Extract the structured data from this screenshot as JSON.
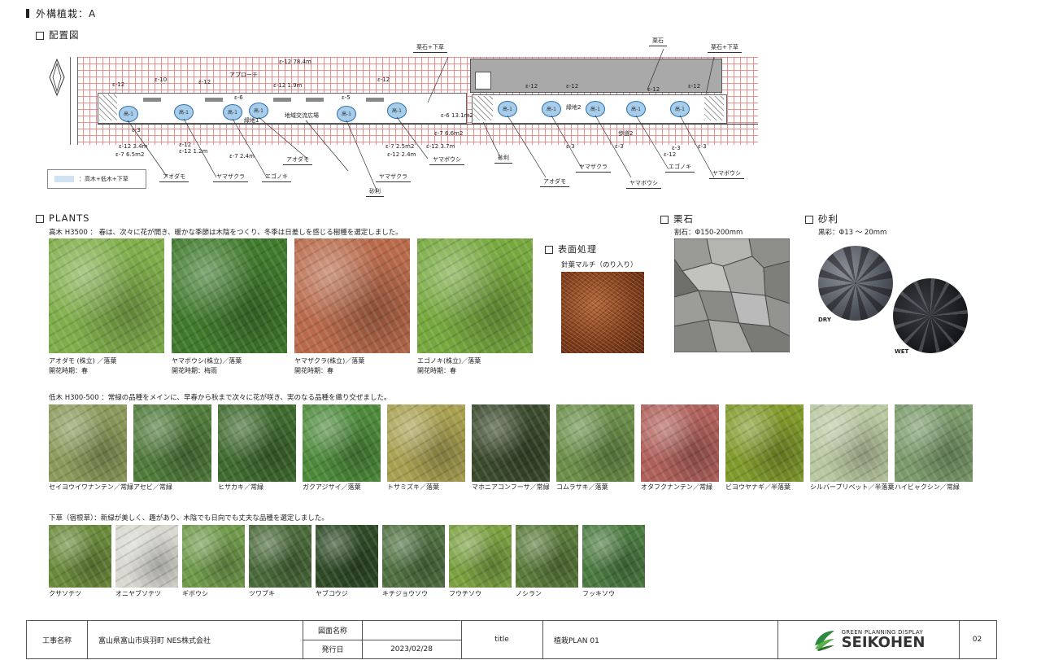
{
  "header": {
    "title": "外構植栽：A"
  },
  "layout_plan": {
    "title": "配置図",
    "legend": "：高木+低木+下草",
    "labels": {
      "approach": "アプローチ",
      "community_plaza": "地域交流広場",
      "green1": "緑地1",
      "green2": "緑地2",
      "walkway": "歩道2",
      "kuriishi_shitakusa_1": "栗石+下草",
      "kuriishi": "栗石",
      "kuriishi_shitakusa_2": "栗石+下草",
      "aodamo_1": "アオダモ",
      "yamazakura_1": "ヤマザクラ",
      "egonoki_1": "エゴノキ",
      "aodamo_2": "アオダモ",
      "jari_1": "砂利",
      "yamazakura_2": "ヤマザクラ",
      "yamaboushi_1": "ヤマボウシ",
      "jari_2": "砂利",
      "aodamo_3": "アオダモ",
      "yamazakura_3": "ヤマザクラ",
      "yamaboushi_2": "ヤマボウシ",
      "egonoki_2": "エゴノキ",
      "yamaboushi_3": "ヤマボウシ"
    },
    "tree_label": "高-1",
    "area_labels": [
      "ε-12 78.4m",
      "ε-10",
      "ε-12",
      "ε-12",
      "ε-6",
      "ε-12 1.9m",
      "ε-12",
      "ε-5",
      "ε-12 3.4m",
      "ε-7 6.5m2",
      "ε-12 1.2m",
      "ε-7 2.4m",
      "ε-7 2.5m2",
      "ε-12 2.4m",
      "ε-6 13.1m2",
      "ε-7 6.6m2",
      "ε-12 3.7m",
      "ε-12",
      "ε-12",
      "ε-12",
      "ε-12",
      "ε-3",
      "ε-3",
      "ε-3",
      "ε-3",
      "ε-12",
      "ε-12",
      "ε-3"
    ]
  },
  "plants": {
    "title": "PLANTS",
    "tall_intro": "高木 H3500 ： 春は、次々に花が開き、暖かな季節は木陰をつくり、冬季は日差しを感じる樹種を選定しました。",
    "tall": [
      {
        "name": "アオダモ (株立) ／落葉",
        "bloom": "開花時期：春",
        "color": "#7fae4a"
      },
      {
        "name": "ヤマボウシ(株立)／落葉",
        "bloom": "開花時期：梅雨",
        "color": "#3f7a2c"
      },
      {
        "name": "ヤマザクラ(株立)／落葉",
        "bloom": "開花時期：春",
        "color": "#b86a4a"
      },
      {
        "name": "エゴノキ(株立)／落葉",
        "bloom": "開花時期：春",
        "color": "#76a83e"
      }
    ],
    "surface": {
      "title": "表面処理",
      "caption": "針葉マルチ（のり入り）"
    },
    "kuriishi": {
      "title": "栗石",
      "caption": "割石：Φ150-200mm"
    },
    "jari": {
      "title": "砂利",
      "caption": "黒彩：Φ13 ～ 20mm",
      "dry": "DRY",
      "wet": "WET"
    },
    "low_intro": "低木 H300-500 ：常緑の品種をメインに、早春から秋まで次々に花が咲き、実のなる品種を織り交ぜました。",
    "low": [
      {
        "name": "セイヨウイワナンテン／常緑",
        "color": "#8a9a5a"
      },
      {
        "name": "アセビ／常緑",
        "color": "#4f7a3a"
      },
      {
        "name": "ヒサカキ／常緑",
        "color": "#3e6a2e"
      },
      {
        "name": "ガクアジサイ／落葉",
        "color": "#4c8a3a"
      },
      {
        "name": "トサミズキ／落葉",
        "color": "#a8a050"
      },
      {
        "name": "マホニアコンフーサ／常緑",
        "color": "#3a4a2c"
      },
      {
        "name": "コムラサキ／落葉",
        "color": "#6a8e48"
      },
      {
        "name": "オタフクナンテン／常緑",
        "color": "#b0605a"
      },
      {
        "name": "ビヨウヤナギ／半落葉",
        "color": "#7f9a2a"
      },
      {
        "name": "シルバープリベット／半落葉",
        "color": "#b8c8a0"
      },
      {
        "name": "ハイビャクシン／常緑",
        "color": "#7a9a6a"
      }
    ],
    "ground_intro": "下草（宿根草）：新緑が美しく、趣があり、木陰でも日向でも丈夫な品種を選定しました。",
    "ground": [
      {
        "name": "クサソテツ",
        "color": "#6a8a3a"
      },
      {
        "name": "オニヤブソテツ",
        "color": "#d8d8d0"
      },
      {
        "name": "ギボウシ",
        "color": "#6f9a4a"
      },
      {
        "name": "ツワブキ",
        "color": "#4a6a3a"
      },
      {
        "name": "ヤブコウジ",
        "color": "#2e4a26"
      },
      {
        "name": "キチジョウソウ",
        "color": "#4f7040"
      },
      {
        "name": "フウチソウ",
        "color": "#7aa040"
      },
      {
        "name": "ノシラン",
        "color": "#5a7a3a"
      },
      {
        "name": "フッキソウ",
        "color": "#4a7a40"
      }
    ]
  },
  "title_block": {
    "project_label": "工事名称",
    "project_value": "富山県富山市呉羽町 NES株式会社",
    "drawing_label": "図面名称",
    "issue_label": "発行日",
    "issue_value": "2023/02/28",
    "title_label": "title",
    "title_value": "植栽PLAN 01",
    "logo_sub": "GREEN PLANNING DISPLAY",
    "logo_main": "SEIKOHEN",
    "page": "02"
  }
}
